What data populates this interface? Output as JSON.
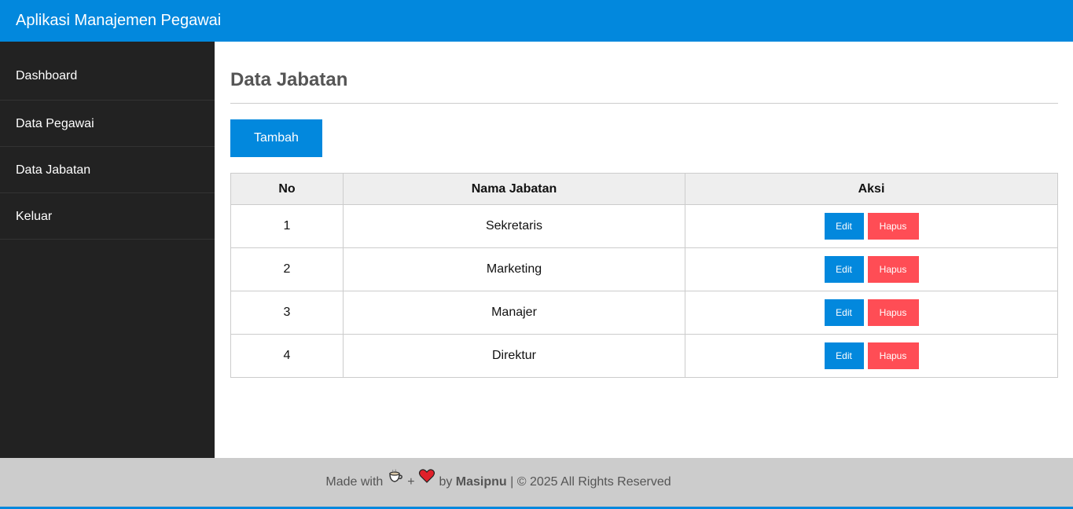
{
  "header": {
    "title": "Aplikasi Manajemen Pegawai"
  },
  "sidebar": {
    "items": [
      {
        "label": "Dashboard"
      },
      {
        "label": "Data Pegawai"
      },
      {
        "label": "Data Jabatan"
      },
      {
        "label": "Keluar"
      }
    ]
  },
  "main": {
    "title": "Data Jabatan",
    "add_label": "Tambah",
    "table": {
      "headers": [
        "No",
        "Nama Jabatan",
        "Aksi"
      ],
      "rows": [
        {
          "no": "1",
          "name": "Sekretaris",
          "edit": "Edit",
          "delete": "Hapus"
        },
        {
          "no": "2",
          "name": "Marketing",
          "edit": "Edit",
          "delete": "Hapus"
        },
        {
          "no": "3",
          "name": "Manajer",
          "edit": "Edit",
          "delete": "Hapus"
        },
        {
          "no": "4",
          "name": "Direktur",
          "edit": "Edit",
          "delete": "Hapus"
        }
      ]
    }
  },
  "footer": {
    "made_with": "Made with",
    "plus": "+",
    "by": "by",
    "author": "Masipnu",
    "rights": "| © 2025 All Rights Reserved",
    "icons": [
      "coffee-icon",
      "heart-icon"
    ]
  },
  "colors": {
    "primary": "#0288dd",
    "danger": "#ff4d55",
    "sidebar_bg": "#222222",
    "footer_bg": "#cccccc"
  }
}
